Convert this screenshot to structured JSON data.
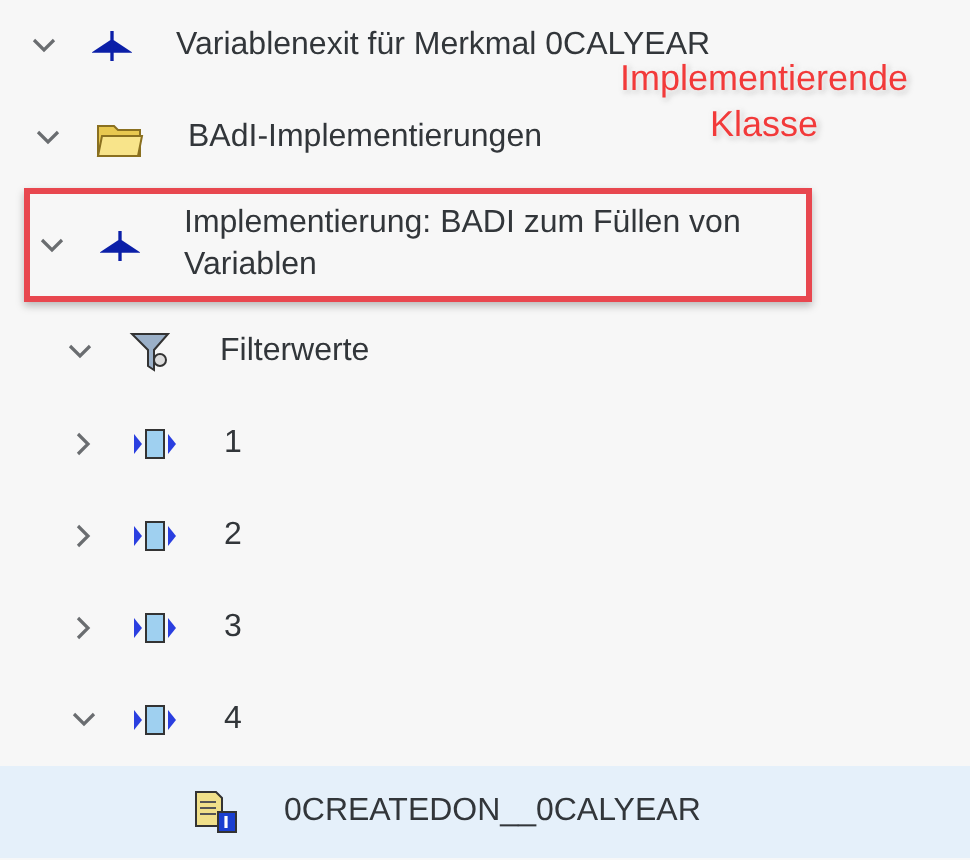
{
  "tree": [
    {
      "kind": "exit",
      "label": "Variablenexit für Merkmal 0CALYEAR",
      "expanded": true,
      "selected": false,
      "highlighted": false,
      "children": [
        {
          "kind": "folder",
          "label": "BAdI-Implementierungen",
          "expanded": true,
          "selected": false,
          "highlighted": false,
          "children": [
            {
              "kind": "exit",
              "label": "Implementierung: BADI zum Füllen von Variablen",
              "expanded": true,
              "selected": false,
              "highlighted": true,
              "children": [
                {
                  "kind": "filter",
                  "label": "Filterwerte",
                  "expanded": true,
                  "selected": false,
                  "highlighted": false,
                  "children": [
                    {
                      "kind": "value",
                      "label": "1",
                      "expanded": false,
                      "selected": false,
                      "highlighted": false
                    },
                    {
                      "kind": "value",
                      "label": "2",
                      "expanded": false,
                      "selected": false,
                      "highlighted": false
                    },
                    {
                      "kind": "value",
                      "label": "3",
                      "expanded": false,
                      "selected": false,
                      "highlighted": false
                    },
                    {
                      "kind": "value",
                      "label": "4",
                      "expanded": true,
                      "selected": false,
                      "highlighted": false,
                      "children": [
                        {
                          "kind": "document",
                          "label": "0CREATEDON__0CALYEAR",
                          "selected": true,
                          "highlighted": false
                        }
                      ]
                    }
                  ]
                }
              ]
            }
          ]
        }
      ]
    }
  ],
  "annotation": {
    "text": "Implementierende Klasse"
  }
}
